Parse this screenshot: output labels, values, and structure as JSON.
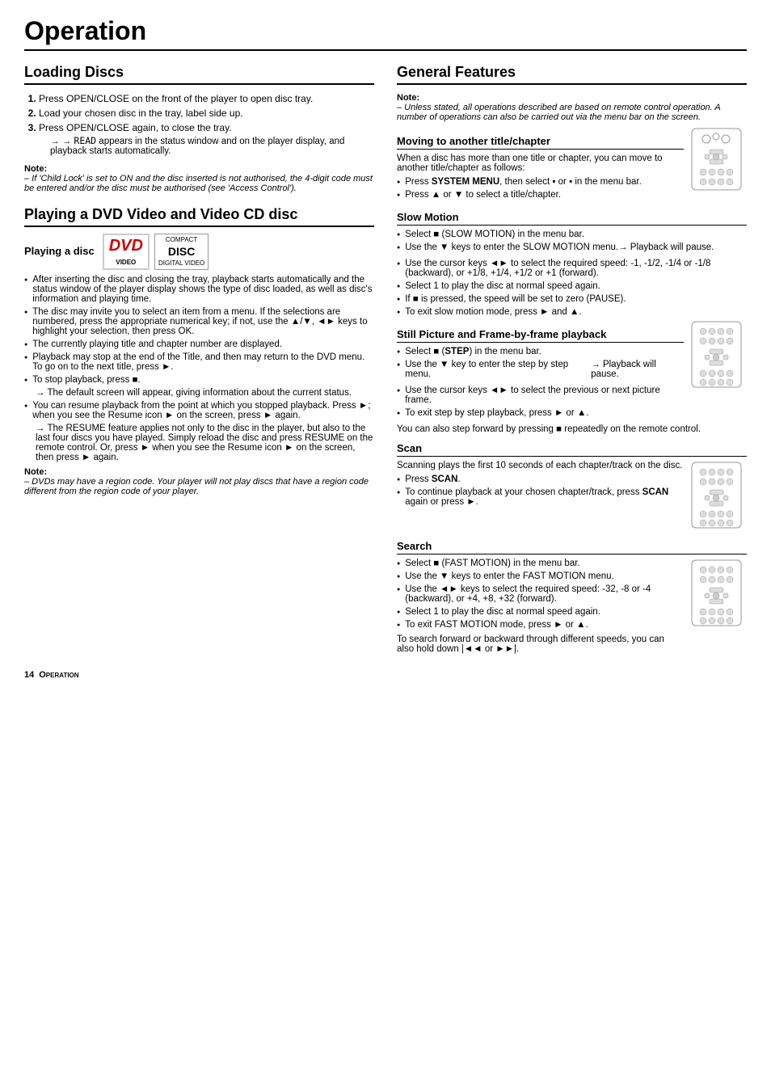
{
  "page": {
    "title": "Operation",
    "footer_number": "14",
    "footer_label": "Operation"
  },
  "loading_discs": {
    "title": "Loading Discs",
    "steps": [
      "Press OPEN/CLOSE on the front of the player to open disc tray.",
      "Load your chosen disc in the tray, label side up.",
      "Press OPEN/CLOSE again, to close the tray."
    ],
    "step3_arrow": "→ READ appears in the status window and on the player display, and playback starts automatically.",
    "note_label": "Note:",
    "note_text": "– If 'Child Lock' is set to ON and the disc inserted is not authorised, the 4-digit code must be entered and/or the disc must be authorised (see 'Access Control')."
  },
  "playing_dvd": {
    "title": "Playing a DVD Video and Video CD disc",
    "playing_disc_subtitle": "Playing a disc",
    "dvd_logo": "DVD",
    "dvd_sub": "VIDEO",
    "disc_logo_line1": "COMPACT",
    "disc_logo_line2": "DISC",
    "disc_logo_line3": "DIGITAL VIDEO",
    "bullets": [
      "After inserting the disc and closing the tray, playback starts automatically and the status window of the player display shows the type of disc loaded, as well as disc's information and playing time.",
      "The disc may invite you to select an item from a menu. If the selections are numbered, press the appropriate numerical key; if not, use the ▲/▼, ◄► keys to highlight your selection, then press OK.",
      "The currently playing title and chapter number are displayed.",
      "Playback may stop at the end of the Title, and then may return to the DVD menu. To go on to the next title, press ►.",
      "To stop playback, press ■."
    ],
    "stop_arrow": "The default screen will appear, giving information about the current status.",
    "resume_bullet": "You can resume playback from the point at which you stopped playback. Press ►; when you see the Resume icon ► on the screen, press ► again.",
    "resume_arrow": "The RESUME feature applies not only to the disc in the player, but also to the last four discs you have played. Simply reload the disc and press RESUME on the remote control. Or, press ► when you see the Resume icon ► on the screen, then press ► again.",
    "note_label": "Note:",
    "note_text": "– DVDs may have a region code. Your player will not play discs that have a region code different from the region code of your player."
  },
  "general_features": {
    "title": "General Features",
    "note_label": "Note:",
    "note_text": "– Unless stated, all operations described are based on remote control operation. A number of operations can also be carried out via the menu bar on the screen.",
    "moving_title": "Moving to another title/chapter",
    "moving_text": "When a disc has more than one title or chapter, you can move to another title/chapter as follows:",
    "moving_bullets": [
      "Press SYSTEM MENU, then select ■ or ■ in the menu bar.",
      "Press ▲ or ▼ to select a title/chapter."
    ],
    "slow_motion_title": "Slow Motion",
    "slow_bullets": [
      "Select ■ (SLOW MOTION) in the menu bar.",
      "Use the ▼ keys to enter the SLOW MOTION menu.",
      "Playback will pause.",
      "Use the cursor keys ◄► to select the required speed: -1, -1/2, -1/4 or -1/8 (backward), or +1/8, +1/4, +1/2 or +1 (forward).",
      "Select 1 to play the disc at normal speed again.",
      "If ■ is pressed, the speed will be set to zero (PAUSE).",
      "To exit slow motion mode, press ► and ▲."
    ],
    "slow_arrow": "Playback will pause.",
    "still_title": "Still Picture and Frame-by-frame playback",
    "still_bullets": [
      "Select ■ (STEP) in the menu bar.",
      "Use the ▼ key to enter the step by step menu.",
      "Playback will pause.",
      "Use the cursor keys ◄► to select the previous or next picture frame.",
      "To exit step by step playback, press ► or ▲."
    ],
    "still_arrow": "Playback will pause.",
    "still_extra": "You can also step forward by pressing ■ repeatedly on the remote control.",
    "scan_title": "Scan",
    "scan_text": "Scanning plays the first 10 seconds of each chapter/track on the disc.",
    "scan_bullets": [
      "Press SCAN.",
      "To continue playback at your chosen chapter/track, press SCAN again or press ►."
    ],
    "search_title": "Search",
    "search_bullets": [
      "Select ■ (FAST MOTION) in the menu bar.",
      "Use the ▼ keys to enter the FAST MOTION menu.",
      "Use the ◄► keys to select the required speed: -32, -8 or -4 (backward), or +4, +8, +32 (forward).",
      "Select 1 to play the disc at normal speed again.",
      "To exit FAST MOTION mode, press ► or ▲."
    ],
    "search_extra": "To search forward or backward through different speeds, you can also hold down |◄◄ or ►►|."
  }
}
